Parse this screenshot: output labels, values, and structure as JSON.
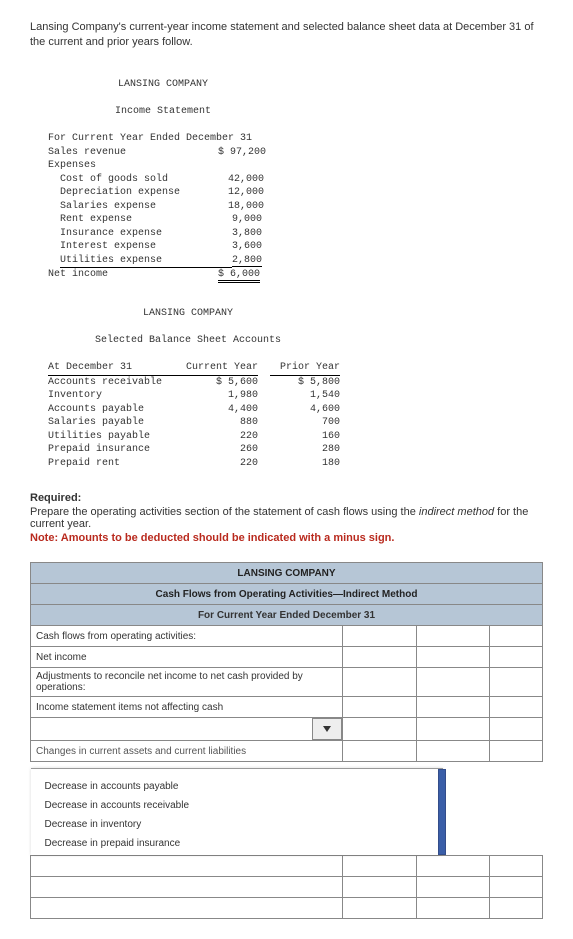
{
  "intro": "Lansing Company's current-year income statement and selected balance sheet data at December 31 of the current and prior years follow.",
  "income_statement": {
    "company": "LANSING COMPANY",
    "title": "Income Statement",
    "period": "For Current Year Ended December 31",
    "lines": {
      "sales_revenue": {
        "label": "Sales revenue",
        "value": "$ 97,200"
      },
      "expenses_header": "Expenses",
      "cogs": {
        "label": "Cost of goods sold",
        "value": "42,000"
      },
      "depreciation": {
        "label": "Depreciation expense",
        "value": "12,000"
      },
      "salaries": {
        "label": "Salaries expense",
        "value": "18,000"
      },
      "rent": {
        "label": "Rent expense",
        "value": "9,000"
      },
      "insurance": {
        "label": "Insurance expense",
        "value": "3,800"
      },
      "interest": {
        "label": "Interest expense",
        "value": "3,600"
      },
      "utilities": {
        "label": "Utilities expense",
        "value": "2,800"
      },
      "net_income": {
        "label": "Net income",
        "value": "$ 6,000"
      }
    }
  },
  "balance_sheet": {
    "company": "LANSING COMPANY",
    "title": "Selected Balance Sheet Accounts",
    "row_header": "At December 31",
    "col_current": "Current Year",
    "col_prior": "Prior Year",
    "rows": {
      "ar": {
        "label": "Accounts receivable",
        "cur": "$ 5,600",
        "pri": "$ 5,800"
      },
      "inv": {
        "label": "Inventory",
        "cur": "1,980",
        "pri": "1,540"
      },
      "ap": {
        "label": "Accounts payable",
        "cur": "4,400",
        "pri": "4,600"
      },
      "sp": {
        "label": "Salaries payable",
        "cur": "880",
        "pri": "700"
      },
      "up": {
        "label": "Utilities payable",
        "cur": "220",
        "pri": "160"
      },
      "pins": {
        "label": "Prepaid insurance",
        "cur": "260",
        "pri": "280"
      },
      "prent": {
        "label": "Prepaid rent",
        "cur": "220",
        "pri": "180"
      }
    }
  },
  "required": {
    "header": "Required:",
    "text_before": "Prepare the operating activities section of the statement of cash flows using the ",
    "italic": "indirect method",
    "text_after": " for the current year.",
    "note": "Note: Amounts to be deducted should be indicated with a minus sign."
  },
  "worksheet": {
    "company_row": "LANSING COMPANY",
    "title_row": "Cash Flows from Operating Activities—Indirect Method",
    "period_row": "For Current Year Ended December 31",
    "rows": {
      "r1": "Cash flows from operating activities:",
      "r2": "Net income",
      "r3": "Adjustments to reconcile net income to net cash provided by operations:",
      "r4": "Income statement items not affecting cash"
    },
    "dropdown_cutoff": "Changes in current assets and current liabilities",
    "options": [
      "Decrease in accounts payable",
      "Decrease in accounts receivable",
      "Decrease in inventory",
      "Decrease in prepaid insurance"
    ]
  }
}
